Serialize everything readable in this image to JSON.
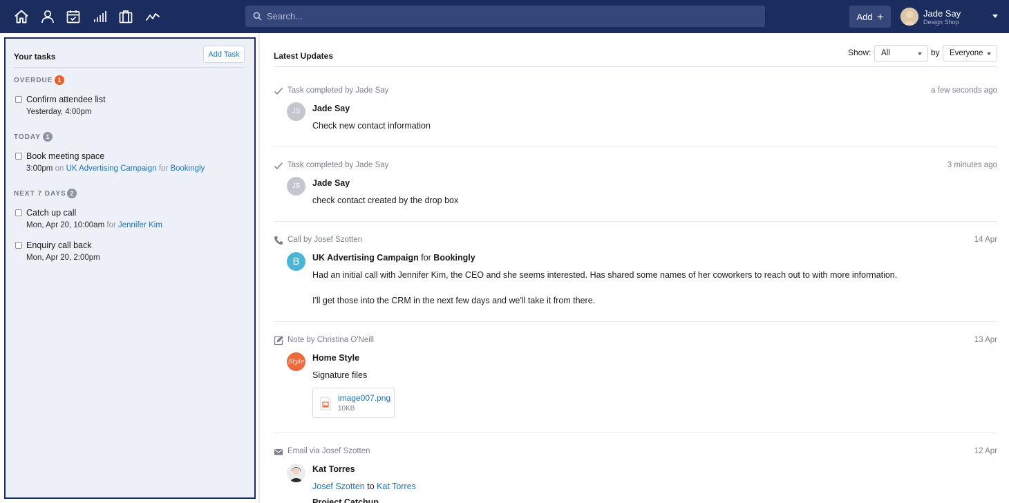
{
  "nav": {
    "icons": [
      "home-icon",
      "person-icon",
      "calendar-check-icon",
      "bar-chart-icon",
      "briefcase-icon",
      "activity-icon"
    ]
  },
  "search": {
    "placeholder": "Search..."
  },
  "header": {
    "add_label": "Add",
    "user_name": "Jade Say",
    "user_company": "Design Shop"
  },
  "tasks": {
    "title": "Your tasks",
    "add_task_label": "Add Task",
    "overdue": {
      "label": "OVERDUE",
      "count": "1",
      "items": [
        {
          "title": "Confirm attendee list",
          "due": "Yesterday, 4:00pm"
        }
      ]
    },
    "today": {
      "label": "TODAY",
      "count": "1",
      "items": [
        {
          "title": "Book meeting space",
          "due": "3:00pm",
          "on_word": "on",
          "project": "UK Advertising Campaign",
          "for_word": "for",
          "org": "Bookingly"
        }
      ]
    },
    "next7": {
      "label": "NEXT 7 DAYS",
      "count": "2",
      "items": [
        {
          "title": "Catch up call",
          "due": "Mon, Apr 20, 10:00am",
          "for_word": "for",
          "person": "Jennifer Kim"
        },
        {
          "title": "Enquiry call back",
          "due": "Mon, Apr 20, 2:00pm"
        }
      ]
    }
  },
  "updates": {
    "title": "Latest Updates",
    "show_label": "Show:",
    "show_value": "All",
    "by_label": "by",
    "by_value": "Everyone",
    "items": [
      {
        "type_icon": "check-icon",
        "type_text": "Task completed by Jade Say",
        "time": "a few seconds ago",
        "avatar_initials": "JS",
        "title": "Jade Say",
        "body": "Check new contact information"
      },
      {
        "type_icon": "check-icon",
        "type_text": "Task completed by Jade Say",
        "time": "3 minutes ago",
        "avatar_initials": "JS",
        "title": "Jade Say",
        "body": "check contact created by the drop box"
      },
      {
        "type_icon": "phone-icon",
        "type_text": "Call by Josef Szotten",
        "time": "14 Apr",
        "avatar_initials": "B",
        "title": "UK Advertising Campaign",
        "title_for": "for",
        "title_org": "Bookingly",
        "body": "Had an initial call with Jennifer Kim, the CEO and she seems interested. Has shared some names of her coworkers to reach out to with more information.",
        "body2": "I'll get those into the CRM in the next few days and we'll take it from there."
      },
      {
        "type_icon": "note-edit-icon",
        "type_text": "Note by Christina O'Neill",
        "time": "13 Apr",
        "avatar_text": "Style",
        "title": "Home Style",
        "body": "Signature files",
        "attachment_name": "image007.png",
        "attachment_size": "10KB"
      },
      {
        "type_icon": "envelope-icon",
        "type_text": "Email via Josef Szotten",
        "time": "12 Apr",
        "title": "Kat Torres",
        "from": "Josef Szotten",
        "to_word": "to",
        "to": "Kat Torres",
        "subject": "Project Catchup"
      }
    ]
  },
  "colors": {
    "topbar": "#1b2d5f",
    "accent_link": "#1a75bb",
    "overdue_badge": "#ef5f2a",
    "bookingly_avatar": "#4bb5d6",
    "homestyle_avatar": "#ef6a3a"
  }
}
